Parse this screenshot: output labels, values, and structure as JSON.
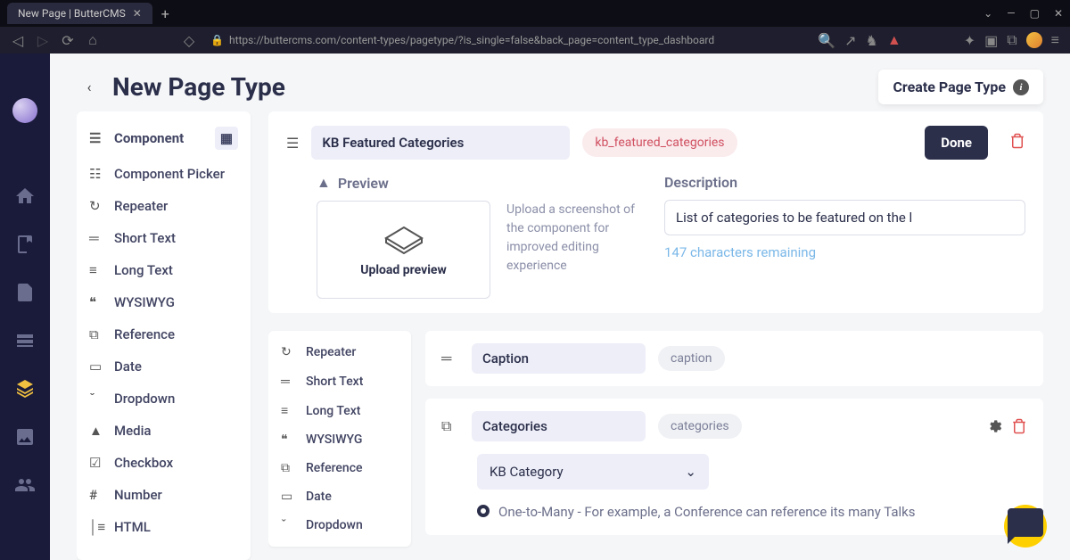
{
  "browser": {
    "tab_title": "New Page | ButterCMS",
    "url": "https://buttercms.com/content-types/pagetype/?is_single=false&back_page=content_type_dashboard"
  },
  "header": {
    "title": "New Page Type",
    "create_btn": "Create Page Type"
  },
  "palette": {
    "component": "Component",
    "component_picker": "Component Picker",
    "repeater": "Repeater",
    "short_text": "Short Text",
    "long_text": "Long Text",
    "wysiwyg": "WYSIWYG",
    "reference": "Reference",
    "date": "Date",
    "dropdown": "Dropdown",
    "media": "Media",
    "checkbox": "Checkbox",
    "number": "Number",
    "html": "HTML"
  },
  "component": {
    "name": "KB Featured Categories",
    "slug": "kb_featured_categories",
    "done": "Done",
    "preview_label": "Preview",
    "upload_text": "Upload preview",
    "upload_help": "Upload a screenshot of the component for improved editing experience",
    "desc_label": "Description",
    "desc_value": "List of categories to be featured on the l",
    "char_remaining": "147 characters remaining"
  },
  "nested_palette": {
    "repeater": "Repeater",
    "short_text": "Short Text",
    "long_text": "Long Text",
    "wysiwyg": "WYSIWYG",
    "reference": "Reference",
    "date": "Date",
    "dropdown": "Dropdown"
  },
  "fields": {
    "caption": {
      "name": "Caption",
      "slug": "caption"
    },
    "categories": {
      "name": "Categories",
      "slug": "categories",
      "ref_type": "KB Category",
      "relation": "One-to-Many - For example, a Conference can reference its many Talks"
    }
  }
}
